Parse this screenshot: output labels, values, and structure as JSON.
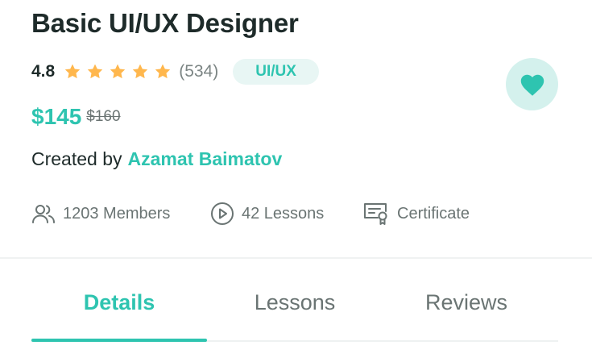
{
  "course": {
    "title": "Basic UI/UX Designer",
    "rating": "4.8",
    "stars": 5,
    "review_count": "(534)",
    "category": "UI/UX"
  },
  "price": {
    "current": "$145",
    "original": "$160"
  },
  "creator": {
    "label": "Created by",
    "name": "Azamat Baimatov"
  },
  "meta": {
    "members": "1203 Members",
    "lessons": "42 Lessons",
    "certificate": "Certificate"
  },
  "tabs": [
    {
      "label": "Details",
      "active": true
    },
    {
      "label": "Lessons",
      "active": false
    },
    {
      "label": "Reviews",
      "active": false
    }
  ],
  "icons": {
    "favorite": "heart-icon",
    "star": "star-icon",
    "members": "users-icon",
    "lessons": "play-circle-icon",
    "certificate": "certificate-icon"
  },
  "colors": {
    "accent": "#2ec4b0",
    "star": "#ffb74d",
    "badge_bg": "#e8f6f4",
    "favorite_bg": "#d4f1ed",
    "text_dark": "#1e2b2a",
    "text_muted": "#6a7473"
  }
}
